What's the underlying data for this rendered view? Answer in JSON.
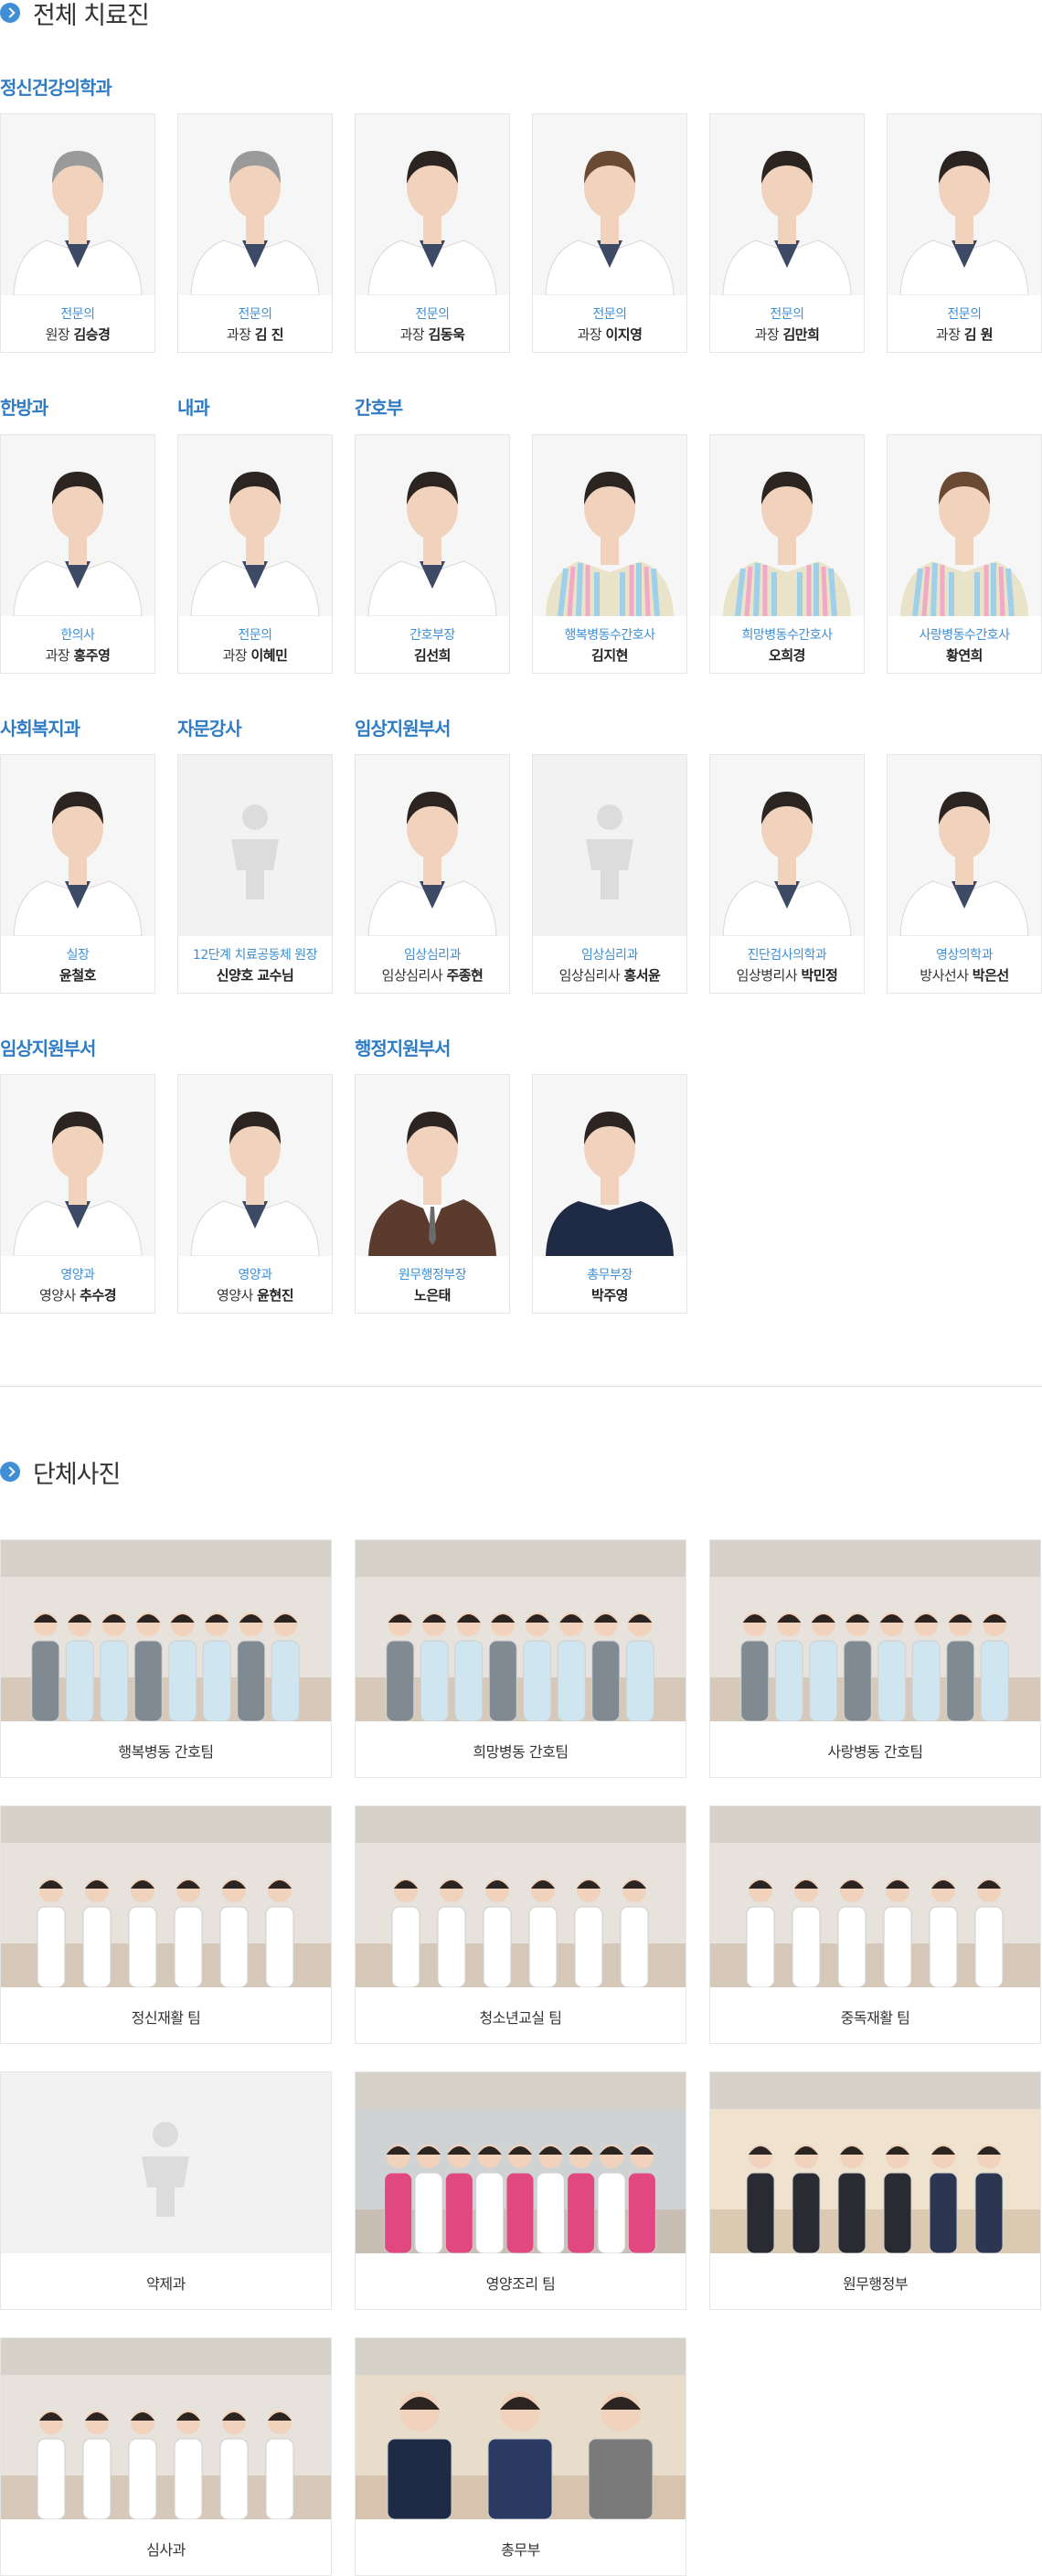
{
  "sections": {
    "staff_title": "전체 치료진",
    "group_title": "단체사진"
  },
  "colors": {
    "accent": "#3f8fd6",
    "dept": "#2f7cc4"
  },
  "departments": [
    {
      "label": "정신건강의학과"
    },
    {
      "label": "한방과"
    },
    {
      "label": "내과"
    },
    {
      "label": "간호부"
    },
    {
      "label": "사회복지과"
    },
    {
      "label": "자문강사"
    },
    {
      "label": "임상지원부서"
    },
    {
      "label": "임상지원부서"
    },
    {
      "label": "행정지원부서"
    }
  ],
  "staff": [
    {
      "role": "전문의",
      "pre": "원장",
      "name": "김승경",
      "coat": "white",
      "hair": "gray"
    },
    {
      "role": "전문의",
      "pre": "과장",
      "name": "김 진",
      "coat": "white",
      "hair": "gray"
    },
    {
      "role": "전문의",
      "pre": "과장",
      "name": "김동욱",
      "coat": "white",
      "hair": "dark"
    },
    {
      "role": "전문의",
      "pre": "과장",
      "name": "이지영",
      "coat": "white",
      "hair": "brown"
    },
    {
      "role": "전문의",
      "pre": "과장",
      "name": "김만희",
      "coat": "white",
      "hair": "dark"
    },
    {
      "role": "전문의",
      "pre": "과장",
      "name": "김 원",
      "coat": "white",
      "hair": "dark"
    },
    {
      "role": "한의사",
      "pre": "과장",
      "name": "홍주영",
      "coat": "white",
      "hair": "dark"
    },
    {
      "role": "전문의",
      "pre": "과장",
      "name": "이혜민",
      "coat": "white",
      "hair": "dark"
    },
    {
      "role": "간호부장",
      "pre": "",
      "name": "김선희",
      "coat": "white",
      "hair": "dark"
    },
    {
      "role": "행복병동수간호사",
      "pre": "",
      "name": "김지현",
      "coat": "stripe",
      "hair": "dark"
    },
    {
      "role": "희망병동수간호사",
      "pre": "",
      "name": "오희경",
      "coat": "stripe",
      "hair": "dark"
    },
    {
      "role": "사랑병동수간호사",
      "pre": "",
      "name": "황연희",
      "coat": "stripe",
      "hair": "brown"
    },
    {
      "role": "실장",
      "pre": "",
      "name": "윤철호",
      "coat": "white",
      "hair": "dark"
    },
    {
      "role": "12단계 치료공동체 원장",
      "pre": "",
      "name": "신양호 교수님",
      "coat": "none",
      "hair": "none"
    },
    {
      "role": "임상심리과",
      "pre": "임상심리사",
      "name": "주종현",
      "coat": "white",
      "hair": "dark"
    },
    {
      "role": "임상심리과",
      "pre": "임상심리사",
      "name": "홍서윤",
      "coat": "none",
      "hair": "none"
    },
    {
      "role": "진단검사의학과",
      "pre": "임상병리사",
      "name": "박민정",
      "coat": "white",
      "hair": "dark"
    },
    {
      "role": "영상의학과",
      "pre": "방사선사",
      "name": "박은선",
      "coat": "white",
      "hair": "dark"
    },
    {
      "role": "영양과",
      "pre": "영양사",
      "name": "추수경",
      "coat": "white",
      "hair": "dark"
    },
    {
      "role": "영양과",
      "pre": "영양사",
      "name": "윤현진",
      "coat": "white",
      "hair": "dark"
    },
    {
      "role": "원무행정부장",
      "pre": "",
      "name": "노은태",
      "coat": "suit",
      "hair": "dark"
    },
    {
      "role": "총무부장",
      "pre": "",
      "name": "박주영",
      "coat": "navy",
      "hair": "dark"
    }
  ],
  "groups": [
    {
      "label": "행복병동 간호팀",
      "kind": "stripe"
    },
    {
      "label": "희망병동 간호팀",
      "kind": "stripe"
    },
    {
      "label": "사랑병동 간호팀",
      "kind": "stripe"
    },
    {
      "label": "정신재활 팀",
      "kind": "white"
    },
    {
      "label": "청소년교실 팀",
      "kind": "white"
    },
    {
      "label": "중독재활 팀",
      "kind": "white"
    },
    {
      "label": "약제과",
      "kind": "none"
    },
    {
      "label": "영양조리 팀",
      "kind": "pink"
    },
    {
      "label": "원무행정부",
      "kind": "suit"
    },
    {
      "label": "심사과",
      "kind": "white"
    },
    {
      "label": "총무부",
      "kind": "mixed"
    }
  ]
}
